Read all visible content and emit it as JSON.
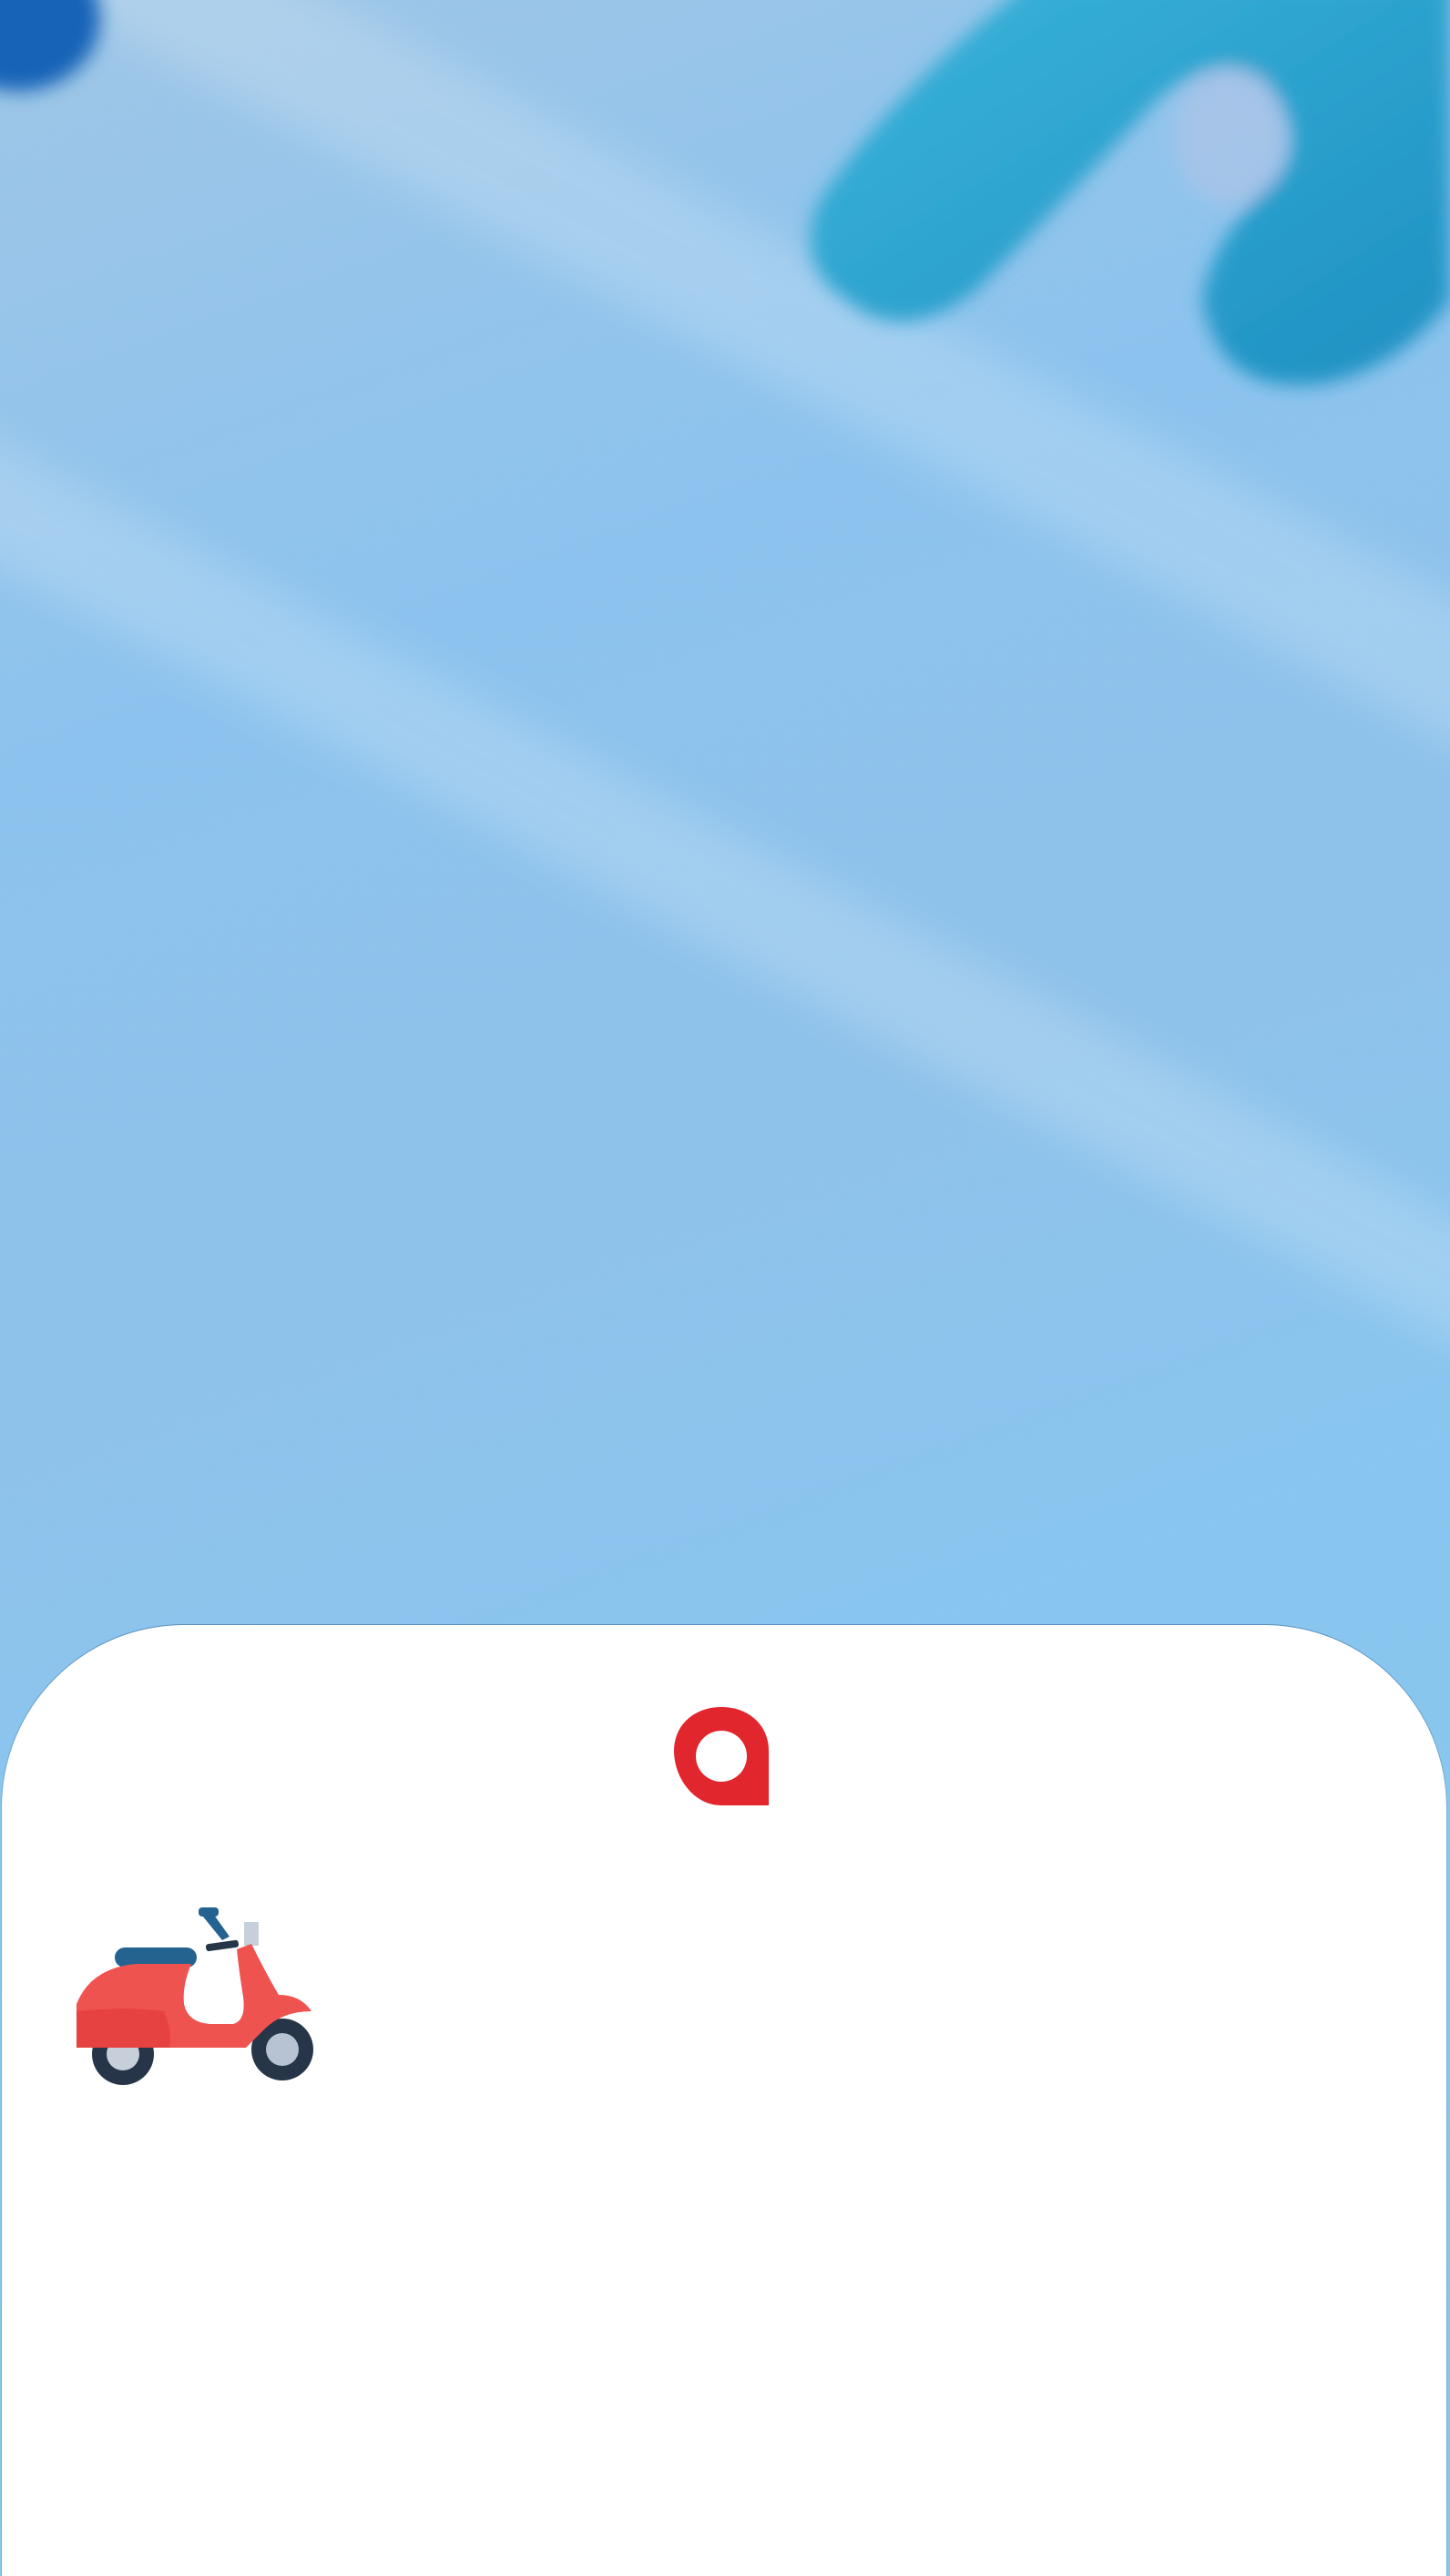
{
  "background": {
    "description_colors": {
      "sky": "#8cc3ee",
      "splash_dark": "#1e90c2",
      "splash_light": "#3ab4da",
      "corner_blob": "#1463b8"
    }
  },
  "bottom_sheet": {
    "background": "#ffffff"
  },
  "icons": {
    "location_pin": {
      "name": "location-pin-icon",
      "color": "#e1262d"
    },
    "scooter": {
      "name": "scooter-icon",
      "body_color": "#ef5350",
      "seat_color": "#24628f",
      "wheel_color": "#263548"
    }
  }
}
